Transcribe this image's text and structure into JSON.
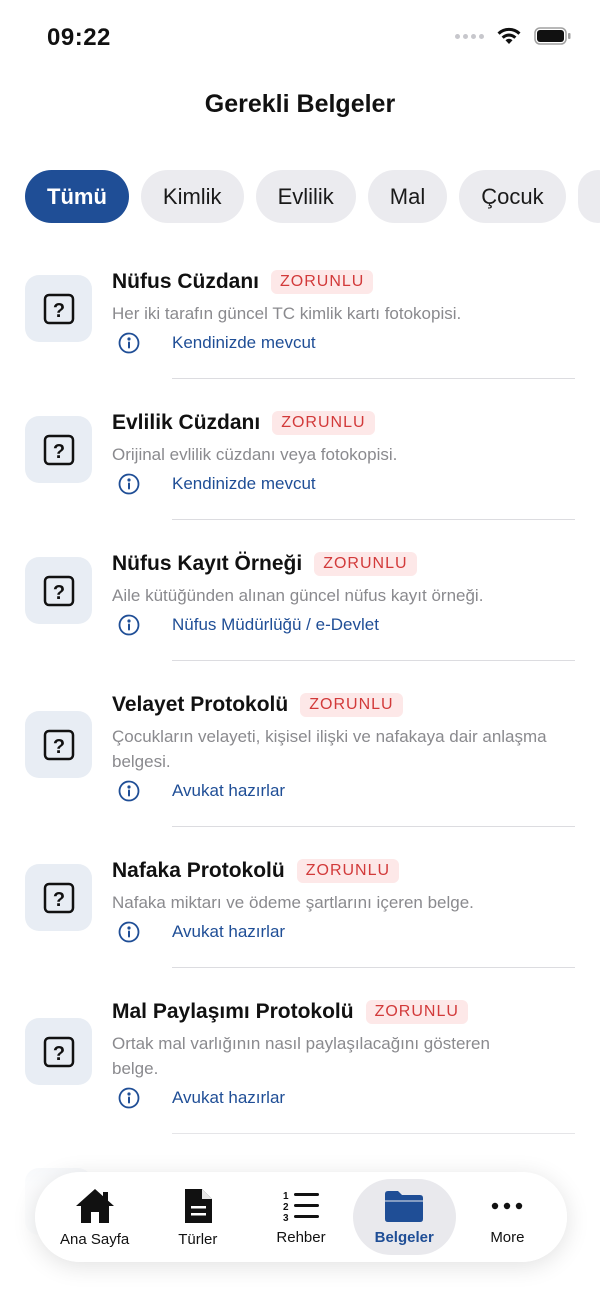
{
  "status": {
    "time": "09:22"
  },
  "header": {
    "title": "Gerekli Belgeler"
  },
  "filters": [
    "Tümü",
    "Kimlik",
    "Evlilik",
    "Mal",
    "Çocuk"
  ],
  "documents": [
    {
      "title": "Nüfus Cüzdanı",
      "badge": "ZORUNLU",
      "description": "Her iki tarafın güncel TC kimlik kartı fotokopisi.",
      "source": "Kendinizde mevcut"
    },
    {
      "title": "Evlilik Cüzdanı",
      "badge": "ZORUNLU",
      "description": "Orijinal evlilik cüzdanı veya fotokopisi.",
      "source": "Kendinizde mevcut"
    },
    {
      "title": "Nüfus Kayıt Örneği",
      "badge": "ZORUNLU",
      "description": "Aile kütüğünden alınan güncel nüfus kayıt örneği.",
      "source": "Nüfus Müdürlüğü / e-Devlet"
    },
    {
      "title": "Velayet Protokolü",
      "badge": "ZORUNLU",
      "description": "Çocukların velayeti, kişisel ilişki ve nafakaya dair anlaşma belgesi.",
      "source": "Avukat hazırlar"
    },
    {
      "title": "Nafaka Protokolü",
      "badge": "ZORUNLU",
      "description": "Nafaka miktarı ve ödeme şartlarını içeren belge.",
      "source": "Avukat hazırlar"
    },
    {
      "title": "Mal Paylaşımı Protokolü",
      "badge": "ZORUNLU",
      "description": "Ortak mal varlığının nasıl paylaşılacağını gösteren belge.",
      "source": "Avukat hazırlar"
    }
  ],
  "tabs": [
    {
      "label": "Ana Sayfa",
      "icon": "home-icon"
    },
    {
      "label": "Türler",
      "icon": "document-icon"
    },
    {
      "label": "Rehber",
      "icon": "numbered-list-icon"
    },
    {
      "label": "Belgeler",
      "icon": "folder-icon",
      "active": true
    },
    {
      "label": "More",
      "icon": "more-icon"
    }
  ],
  "colors": {
    "accent": "#1f4e96",
    "badge_text": "#d23a3a",
    "badge_bg": "#fde8e8",
    "chip_bg": "#ebebef",
    "icon_box_bg": "#e8edf4"
  }
}
